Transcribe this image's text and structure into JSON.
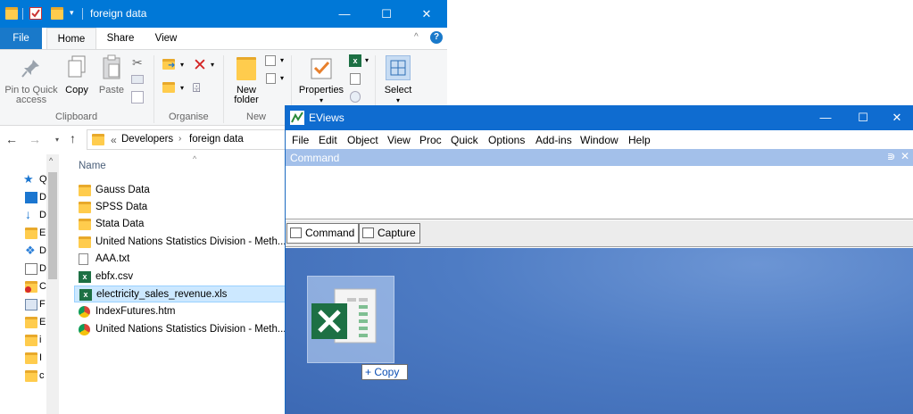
{
  "explorer": {
    "title": "foreign data",
    "ribbon_tabs": [
      "File",
      "Home",
      "Share",
      "View"
    ],
    "ribbon": {
      "pin_label": "Pin to Quick",
      "pin_label2": "access",
      "copy_label": "Copy",
      "paste_label": "Paste",
      "new_folder_label": "New",
      "new_folder_label2": "folder",
      "properties_label": "Properties",
      "select_label": "Select",
      "groups": [
        "Clipboard",
        "Organise",
        "New"
      ]
    },
    "address": {
      "prefix": "«",
      "crumbs": [
        "Developers",
        "foreign data"
      ]
    },
    "nav_chars": [
      "Q",
      "D",
      "D",
      "E",
      "D",
      "D",
      "C",
      "F",
      "E",
      "i",
      "I",
      "c"
    ],
    "column_name": "Name",
    "files": [
      {
        "name": "Gauss Data",
        "type": "folder"
      },
      {
        "name": "SPSS Data",
        "type": "folder"
      },
      {
        "name": "Stata Data",
        "type": "folder"
      },
      {
        "name": "United Nations Statistics Division - Meth...",
        "type": "folder"
      },
      {
        "name": "AAA.txt",
        "type": "txt"
      },
      {
        "name": "ebfx.csv",
        "type": "csv"
      },
      {
        "name": "electricity_sales_revenue.xls",
        "type": "xls"
      },
      {
        "name": "IndexFutures.htm",
        "type": "htm"
      },
      {
        "name": "United Nations Statistics Division - Meth...",
        "type": "htm"
      }
    ]
  },
  "eviews": {
    "title": "EViews",
    "menu": [
      "File",
      "Edit",
      "Object",
      "View",
      "Proc",
      "Quick",
      "Options",
      "Add-ins",
      "Window",
      "Help"
    ],
    "command_header": "Command",
    "tabs": [
      "Command",
      "Capture"
    ],
    "drag_tip": "+ Copy"
  },
  "colors": {
    "explorer_title": "#0078d7",
    "eviews_title": "#0f6cd0",
    "selection": "#cce8ff",
    "excel_green": "#1d7044"
  }
}
